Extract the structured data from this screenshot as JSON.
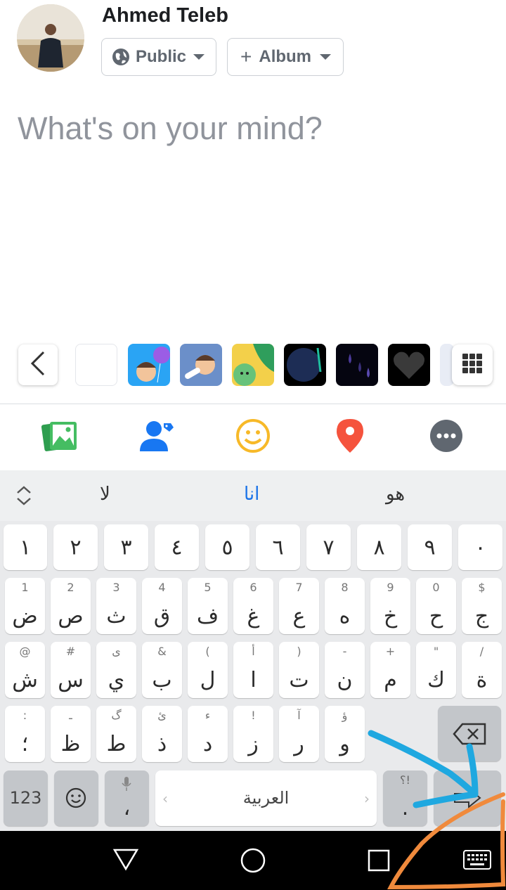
{
  "user": {
    "name": "Ahmed Teleb"
  },
  "privacy": {
    "label": "Public",
    "icon": "globe-icon"
  },
  "album": {
    "label": "Album",
    "icon": "plus-icon"
  },
  "composer": {
    "placeholder": "What's on your mind?"
  },
  "suggestions": [
    "لا",
    "انا",
    "هو"
  ],
  "keyboard": {
    "digits": [
      "١",
      "٢",
      "٣",
      "٤",
      "٥",
      "٦",
      "٧",
      "٨",
      "٩",
      "٠"
    ],
    "row1": [
      {
        "sub": "1",
        "main": "ض"
      },
      {
        "sub": "2",
        "main": "ص"
      },
      {
        "sub": "3",
        "main": "ث"
      },
      {
        "sub": "4",
        "main": "ق"
      },
      {
        "sub": "5",
        "main": "ف"
      },
      {
        "sub": "6",
        "main": "غ"
      },
      {
        "sub": "7",
        "main": "ع"
      },
      {
        "sub": "8",
        "main": "ه"
      },
      {
        "sub": "9",
        "main": "خ"
      },
      {
        "sub": "0",
        "main": "ح"
      },
      {
        "sub": "$",
        "main": "ج"
      }
    ],
    "row2": [
      {
        "sub": "@",
        "main": "ش"
      },
      {
        "sub": "#",
        "main": "س"
      },
      {
        "sub": "ى",
        "main": "ي"
      },
      {
        "sub": "&",
        "main": "ب"
      },
      {
        "sub": "(",
        "main": "ل"
      },
      {
        "sub": "أ",
        "main": "ا"
      },
      {
        "sub": ")",
        "main": "ت"
      },
      {
        "sub": "-",
        "main": "ن"
      },
      {
        "sub": "+",
        "main": "م"
      },
      {
        "sub": "\"",
        "main": "ك"
      },
      {
        "sub": "/",
        "main": "ة"
      }
    ],
    "row3": [
      {
        "sub": ":",
        "main": "؛"
      },
      {
        "sub": "ـ",
        "main": "ظ"
      },
      {
        "sub": "گ",
        "main": "ط"
      },
      {
        "sub": "ئ",
        "main": "ذ"
      },
      {
        "sub": "ء",
        "main": "د"
      },
      {
        "sub": "!",
        "main": "ز"
      },
      {
        "sub": "آ",
        "main": "ر"
      },
      {
        "sub": "ؤ",
        "main": "و"
      }
    ],
    "symbols_label": "123",
    "comma": "،",
    "space_label": "العربية",
    "punct_sub": "؟!",
    "period": "."
  },
  "colors": {
    "photo": "#45bd62",
    "tag": "#1877f2",
    "feeling": "#f7b928",
    "location": "#f5533d",
    "more": "#606770",
    "annotation_blue": "#1fa8e0",
    "annotation_orange": "#f08a3c"
  }
}
